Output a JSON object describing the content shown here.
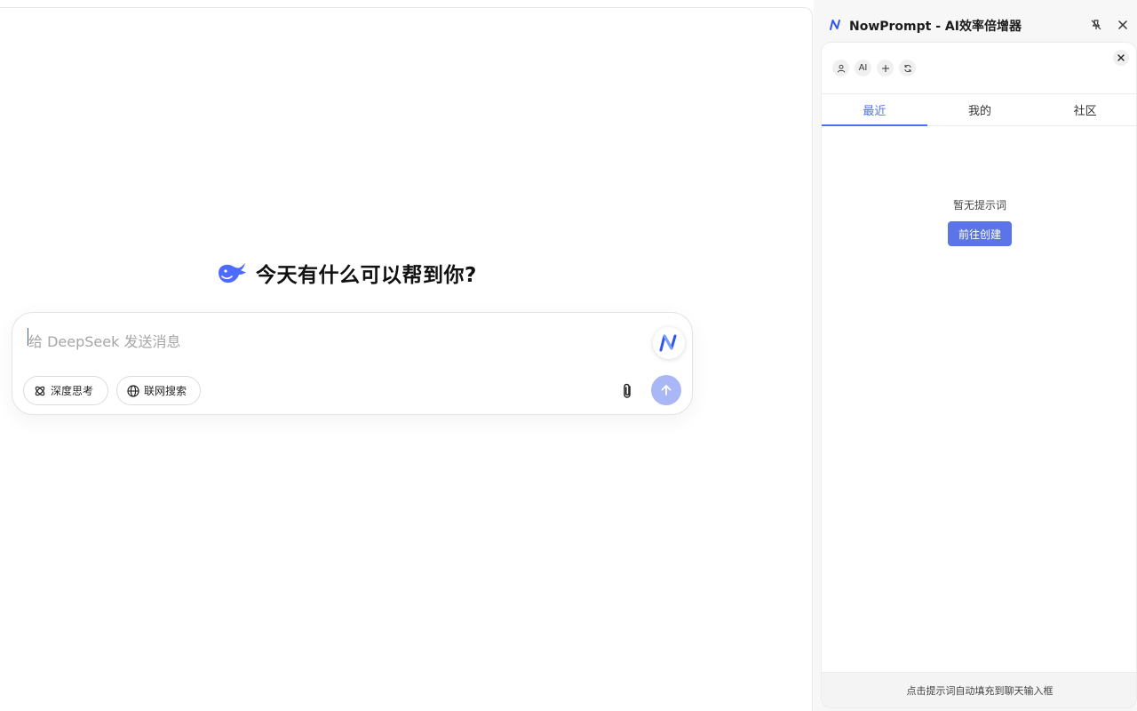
{
  "main": {
    "greeting": "今天有什么可以帮到你?",
    "composer": {
      "placeholder": "给 DeepSeek 发送消息",
      "deep_think_label": "深度思考",
      "web_search_label": "联网搜索"
    }
  },
  "panel": {
    "title": "NowPrompt - AI效率倍增器",
    "toolbar": {
      "ai_label": "AI"
    },
    "tabs": [
      {
        "label": "最近",
        "active": true
      },
      {
        "label": "我的",
        "active": false
      },
      {
        "label": "社区",
        "active": false
      }
    ],
    "empty_text": "暂无提示词",
    "create_label": "前往创建",
    "footer": "点击提示词自动填充到聊天输入框"
  },
  "colors": {
    "accent": "#4f6ef7",
    "send_disabled": "#a9b7f7",
    "create_button": "#5b74e8",
    "whale": "#4d6bfe"
  }
}
